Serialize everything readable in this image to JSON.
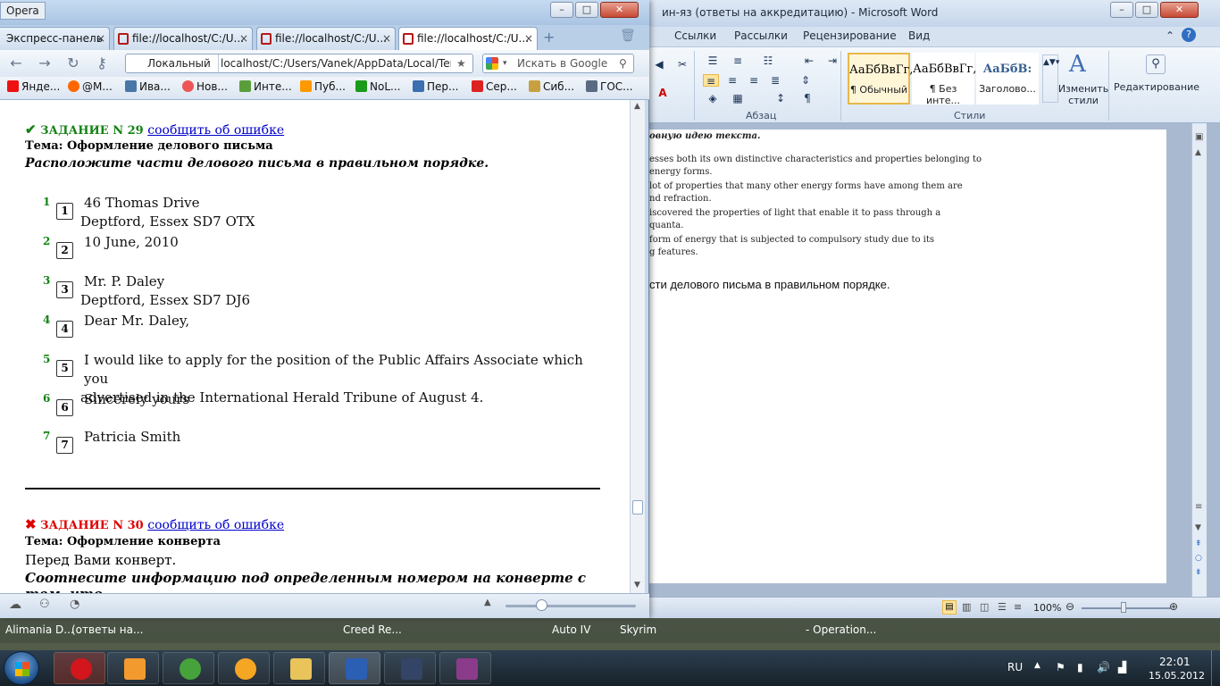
{
  "word": {
    "title": "ин-яз (ответы на аккредитацию)  -  Microsoft Word",
    "tabs": [
      "Ссылки",
      "Рассылки",
      "Рецензирование",
      "Вид"
    ],
    "groups": {
      "paragraph": "Абзац",
      "styles": "Стили"
    },
    "styles": [
      {
        "sample": "АаБбВвГг,",
        "name": "¶ Обычный"
      },
      {
        "sample": "АаБбВвГг,",
        "name": "¶ Без инте..."
      },
      {
        "sample": "АаБбВ:",
        "name": "Заголово..."
      }
    ],
    "change_styles": "Изменить стили",
    "editing": "Редактирование",
    "doc_lines": [
      "овную идею текста.",
      "esses both its own distinctive characteristics and properties belonging to",
      "energy forms.",
      "lot of properties that many other energy forms have among them are",
      "nd refraction.",
      "iscovered the properties of light that enable it to pass through a",
      "quanta.",
      "form of energy that is subjected to compulsory study due to its",
      "g features."
    ],
    "doc_sans_line": "сти делового письма в правильном порядке.",
    "zoom": "100%"
  },
  "opera": {
    "title": "Opera",
    "tabs": [
      {
        "label": "Экспресс-панель",
        "active": false
      },
      {
        "label": "file://localhost/C:/U...",
        "active": false
      },
      {
        "label": "file://localhost/C:/U...",
        "active": false
      },
      {
        "label": "file://localhost/C:/U...",
        "active": true
      }
    ],
    "address": {
      "site": "Локальный",
      "url": "localhost/C:/Users/Vanek/AppData/Local/Temp/f"
    },
    "search_placeholder": "Искать в Google",
    "bookmarks": [
      "Янде...",
      "@M...",
      "Ива...",
      "Нов...",
      "Инте...",
      "Пуб...",
      "NoL...",
      "Пер...",
      "Сер...",
      "Сиб...",
      "ГОС..."
    ]
  },
  "task29": {
    "title": "ЗАДАНИЕ N 29",
    "report_link": "сообщить об ошибке",
    "topic": "Тема: Оформление делового письма",
    "instruction": "Расположите части делового письма в правильном порядке.",
    "items": [
      {
        "num": "1",
        "box": "1",
        "line1": "46 Thomas Drive",
        "line2": "Deptford, Essex SD7 OTX"
      },
      {
        "num": "2",
        "box": "2",
        "line1": "10 June, 2010",
        "line2": ""
      },
      {
        "num": "3",
        "box": "3",
        "line1": "Mr. P. Daley",
        "line2": "Deptford, Essex SD7 DJ6"
      },
      {
        "num": "4",
        "box": "4",
        "line1": "Dear Mr. Daley,",
        "line2": ""
      },
      {
        "num": "5",
        "box": "5",
        "line1": "I would like to apply for the position of the Public Affairs Associate which you",
        "line2": "advertised in the International Herald Tribune of August 4."
      },
      {
        "num": "6",
        "box": "6",
        "line1": "Sincerely yours",
        "line2": ""
      },
      {
        "num": "7",
        "box": "7",
        "line1": "Patricia Smith",
        "line2": ""
      }
    ]
  },
  "task30": {
    "title": "ЗАДАНИЕ N 30",
    "report_link": "сообщить об ошибке",
    "topic": "Тема: Оформление конверта",
    "intro": "Перед Вами конверт.",
    "instruction": "Соотнесите информацию под определенным номером на конверте с тем, что"
  },
  "taskbar": {
    "windows": [
      "Alimania D...",
      "(ответы на...",
      "Creed Re...",
      "Auto IV",
      "Skyrim",
      "- Operation..."
    ],
    "lang": "RU",
    "time": "22:01",
    "date": "15.05.2012"
  },
  "colors": {
    "correct": "#148214",
    "wrong": "#e00000",
    "link": "#0000cc"
  }
}
